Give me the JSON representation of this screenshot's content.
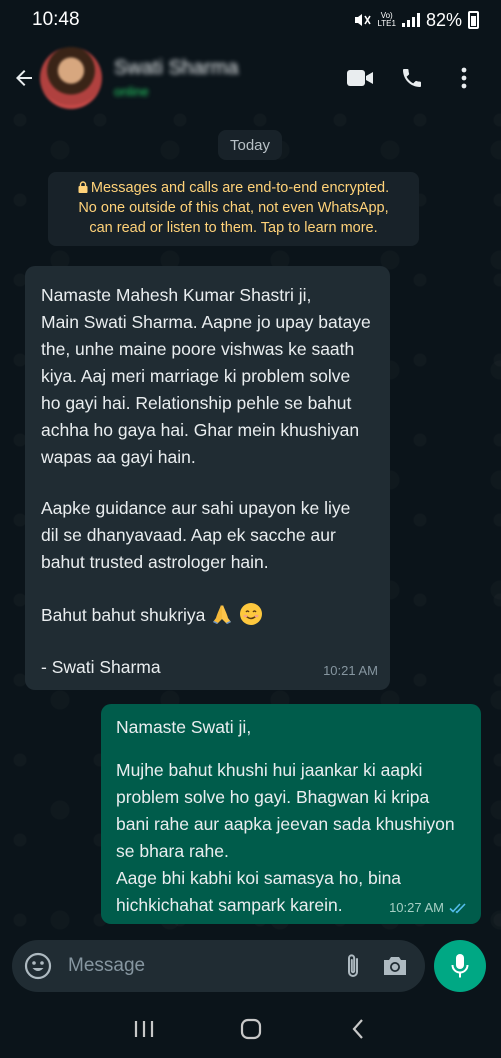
{
  "status_bar": {
    "time": "10:48",
    "network_label_top": "Vo)) LTE1",
    "network_label_line1": "Vo)",
    "network_label_line2": "LTE1",
    "battery": "82%"
  },
  "header": {
    "contact_name": "Swati Sharma",
    "contact_status": "online"
  },
  "date_chip": "Today",
  "encryption_notice": {
    "line1": "Messages and calls are end-to-end encrypted.",
    "line2": "No one outside of this chat, not even WhatsApp,",
    "line3": "can read or listen to them. Tap to learn more."
  },
  "messages": {
    "incoming": {
      "lines": [
        "Namaste Mahesh Kumar Shastri ji,",
        "Main Swati Sharma. Aapne jo upay bataye",
        "the, unhe maine poore vishwas ke saath",
        "kiya. Aaj meri marriage ki problem solve",
        "ho gayi hai. Relationship pehle se bahut",
        "achha ho gaya hai. Ghar mein khushiyan",
        "wapas aa gayi hain.",
        "Aapke guidance aur sahi upayon ke liye",
        "dil se dhanyavaad. Aap ek sacche aur",
        "bahut trusted astrologer hain.",
        "Bahut bahut shukriya",
        "- Swati Sharma"
      ],
      "time": "10:21 AM"
    },
    "outgoing": {
      "lines": [
        "Namaste Swati ji,",
        "Mujhe bahut khushi hui jaankar ki aapki",
        "problem solve ho gayi. Bhagwan ki kripa",
        "bani rahe aur aapka jeevan sada khushiyon",
        "se bhara rahe.",
        "Aage bhi kabhi koi samasya ho, bina",
        "hichkichahat sampark karein."
      ],
      "time": "10:27 AM",
      "read_status": "read"
    }
  },
  "composer": {
    "placeholder": "Message"
  },
  "colors": {
    "background": "#0b141a",
    "incoming_bubble": "#202c33",
    "outgoing_bubble": "#005c4b",
    "accent": "#00a884",
    "read_tick": "#53bdeb",
    "notice_text": "#ffd279"
  }
}
